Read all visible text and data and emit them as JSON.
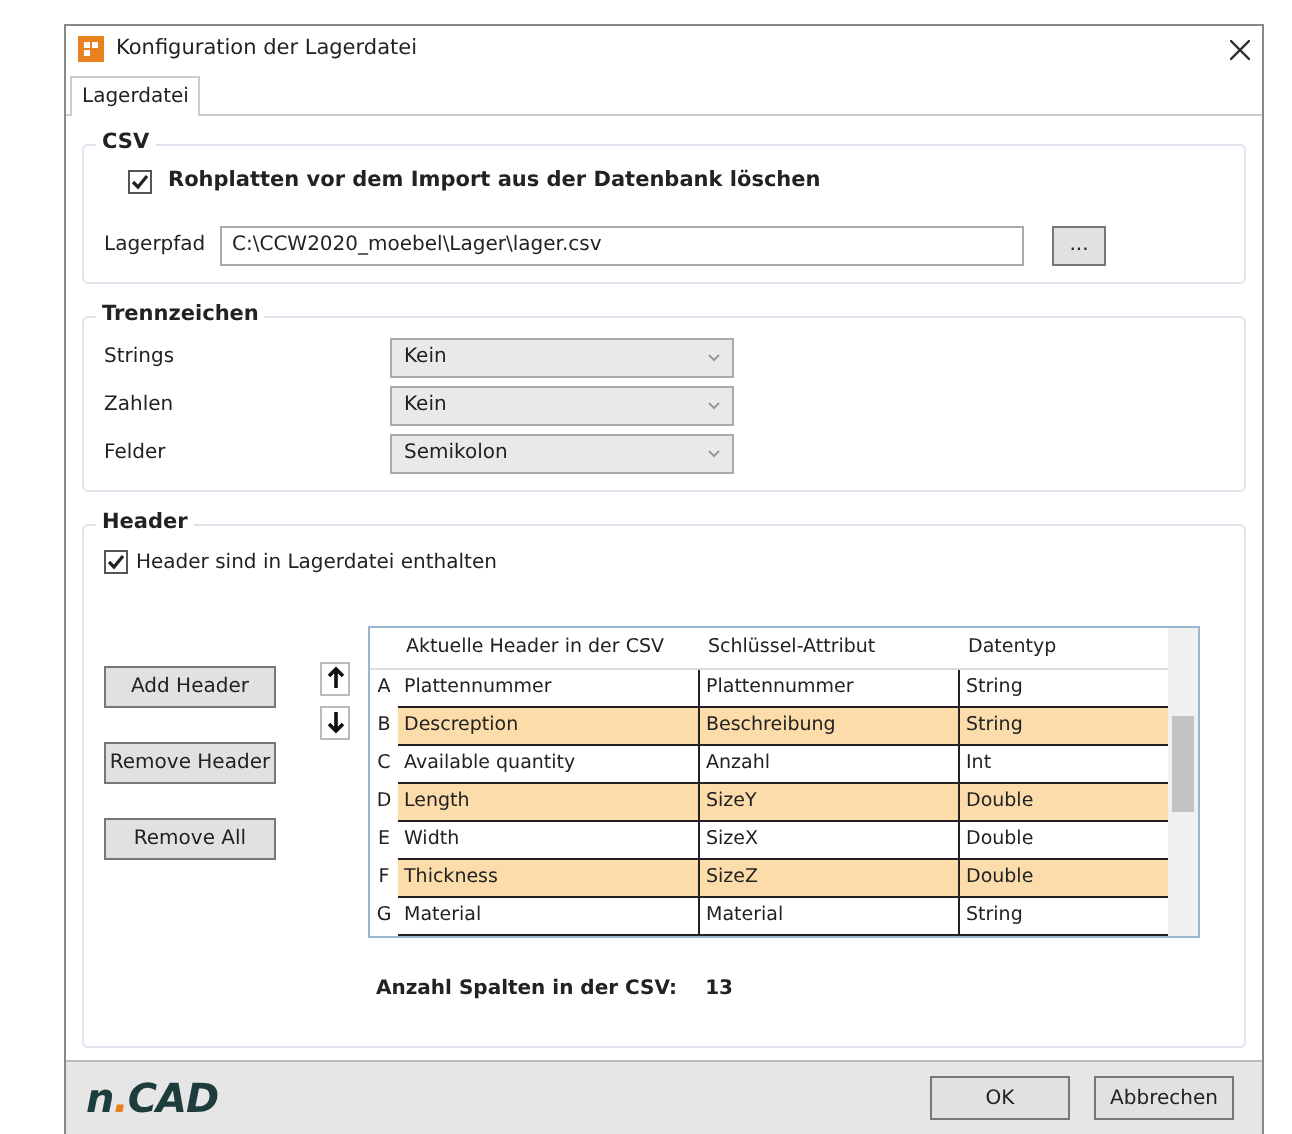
{
  "window": {
    "title": "Konfiguration der Lagerdatei"
  },
  "tabs": [
    {
      "label": "Lagerdatei",
      "selected": true
    }
  ],
  "csv": {
    "title": "CSV",
    "delete_checkbox": {
      "label": "Rohplatten vor dem Import aus der Datenbank löschen",
      "checked": true
    },
    "path_label": "Lagerpfad",
    "path_value": "C:\\CCW2020_moebel\\Lager\\lager.csv",
    "browse_button": "..."
  },
  "separators": {
    "title": "Trennzeichen",
    "rows": [
      {
        "label": "Strings",
        "value": "Kein"
      },
      {
        "label": "Zahlen",
        "value": "Kein"
      },
      {
        "label": "Felder",
        "value": "Semikolon"
      }
    ]
  },
  "header": {
    "title": "Header",
    "included_checkbox": {
      "label": "Header sind in Lagerdatei enthalten",
      "checked": true
    },
    "buttons": [
      "Add Header",
      "Remove Header",
      "Remove All"
    ],
    "move_buttons": [
      {
        "kind": "up"
      },
      {
        "kind": "down"
      }
    ],
    "table": {
      "columns": [
        "Aktuelle Header in der CSV",
        "Schlüssel-Attribut",
        "Datentyp"
      ],
      "rows": [
        {
          "letter": "A",
          "cells": [
            "Plattennummer",
            "Plattennummer",
            "String"
          ],
          "highlighted": false
        },
        {
          "letter": "B",
          "cells": [
            "Descreption",
            "Beschreibung",
            "String"
          ],
          "highlighted": true
        },
        {
          "letter": "C",
          "cells": [
            "Available quantity",
            "Anzahl",
            "Int"
          ],
          "highlighted": false
        },
        {
          "letter": "D",
          "cells": [
            "Length",
            "SizeY",
            "Double"
          ],
          "highlighted": true
        },
        {
          "letter": "E",
          "cells": [
            "Width",
            "SizeX",
            "Double"
          ],
          "highlighted": false
        },
        {
          "letter": "F",
          "cells": [
            "Thickness",
            "SizeZ",
            "Double"
          ],
          "highlighted": true
        },
        {
          "letter": "G",
          "cells": [
            "Material",
            "Material",
            "String"
          ],
          "highlighted": false
        }
      ]
    },
    "column_count_label": "Anzahl Spalten in der CSV:",
    "column_count": "13"
  },
  "footer": {
    "logo": [
      "n",
      ".",
      "CAD"
    ],
    "buttons": [
      "OK",
      "Abbrechen"
    ]
  }
}
